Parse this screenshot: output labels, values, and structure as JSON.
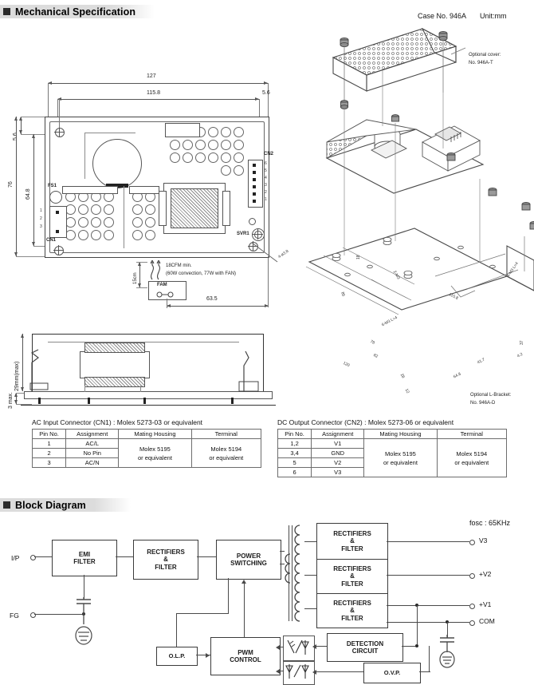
{
  "sections": {
    "mechanical": "Mechanical Specification",
    "block": "Block Diagram"
  },
  "case_info": {
    "case_no": "Case No. 946A",
    "unit": "Unit:mm"
  },
  "notes": {
    "optional_cover": "Optional cover:",
    "optional_cover_no": "No. 946A-T",
    "optional_bracket": "Optional L-Bracket:",
    "optional_bracket_no": "No. 946A-D",
    "airflow": "18CFM min.",
    "airflow_detail": "(60W convection, 77W with FAN)",
    "fan_label": "FAM",
    "fan_distance": "15cm",
    "fosc": "fosc : 65KHz"
  },
  "topview_dims": {
    "width_total": "127",
    "width_inner": "115.8",
    "edge_right": "5.6",
    "edge_top": "5.6",
    "height_total": "76",
    "height_inner": "64.8",
    "fan_offset": "63.5",
    "hole_spec": "4-ø3.8"
  },
  "sideview_dims": {
    "height": "29mm(max)",
    "standoff": "3 max."
  },
  "iso_dims": {
    "d1": "18",
    "d2": "2-M3",
    "d3": "85",
    "d4": "115.8",
    "d5": "6-M3 L=4",
    "d6": "4-M3 L=4",
    "d7": "120",
    "d8": "82",
    "d9": "78",
    "d10": "28",
    "d11": "12",
    "d12": "41.7",
    "d13": "64.8",
    "d14": "37",
    "d15": "4.2"
  },
  "board_refs": {
    "fs1": "FS1",
    "cn1": "CN1",
    "cn2": "CN2",
    "svr1": "SVR1",
    "cn1_pins": [
      "1",
      "2",
      "3"
    ],
    "cn2_pins": [
      "6",
      "5",
      "4",
      "3",
      "2",
      "1"
    ]
  },
  "tables": {
    "ac_input": {
      "title": "AC Input Connector (CN1) : Molex 5273-03  or equivalent",
      "headers": [
        "Pin No.",
        "Assignment",
        "Mating Housing",
        "Terminal"
      ],
      "rows": [
        {
          "pin": "1",
          "assignment": "AC/L"
        },
        {
          "pin": "2",
          "assignment": "No Pin"
        },
        {
          "pin": "3",
          "assignment": "AC/N"
        }
      ],
      "mating_housing": "Molex 5195\nor equivalent",
      "mating_housing_l1": "Molex 5195",
      "mating_housing_l2": "or equivalent",
      "terminal_l1": "Molex 5194",
      "terminal_l2": "or equivalent"
    },
    "dc_output": {
      "title": "DC Output Connector (CN2) : Molex 5273-06 or equivalent",
      "headers": [
        "Pin No.",
        "Assignment",
        "Mating Housing",
        "Terminal"
      ],
      "rows": [
        {
          "pin": "1,2",
          "assignment": "V1"
        },
        {
          "pin": "3,4",
          "assignment": "GND"
        },
        {
          "pin": "5",
          "assignment": "V2"
        },
        {
          "pin": "6",
          "assignment": "V3"
        }
      ],
      "mating_housing_l1": "Molex 5195",
      "mating_housing_l2": "or equivalent",
      "terminal_l1": "Molex 5194",
      "terminal_l2": "or equivalent"
    }
  },
  "block_diagram": {
    "inputs": [
      {
        "id": "ip",
        "label": "I/P"
      },
      {
        "id": "fg",
        "label": "FG"
      }
    ],
    "outputs": [
      {
        "id": "v3",
        "label": "V3"
      },
      {
        "id": "v2",
        "label": "+V2"
      },
      {
        "id": "v1",
        "label": "+V1"
      },
      {
        "id": "com",
        "label": "COM"
      }
    ],
    "blocks": [
      {
        "id": "emi",
        "l1": "EMI",
        "l2": "FILTER"
      },
      {
        "id": "rect_in",
        "l1": "RECTIFIERS",
        "l2": "&",
        "l3": "FILTER"
      },
      {
        "id": "power_sw",
        "l1": "POWER",
        "l2": "SWITCHING"
      },
      {
        "id": "rect_v3",
        "l1": "RECTIFIERS",
        "l2": "&",
        "l3": "FILTER"
      },
      {
        "id": "rect_v2",
        "l1": "RECTIFIERS",
        "l2": "&",
        "l3": "FILTER"
      },
      {
        "id": "rect_v1",
        "l1": "RECTIFIERS",
        "l2": "&",
        "l3": "FILTER"
      },
      {
        "id": "olp",
        "l1": "O.L.P."
      },
      {
        "id": "pwm",
        "l1": "PWM",
        "l2": "CONTROL"
      },
      {
        "id": "detection",
        "l1": "DETECTION",
        "l2": "CIRCUIT"
      },
      {
        "id": "ovp",
        "l1": "O.V.P."
      }
    ]
  }
}
